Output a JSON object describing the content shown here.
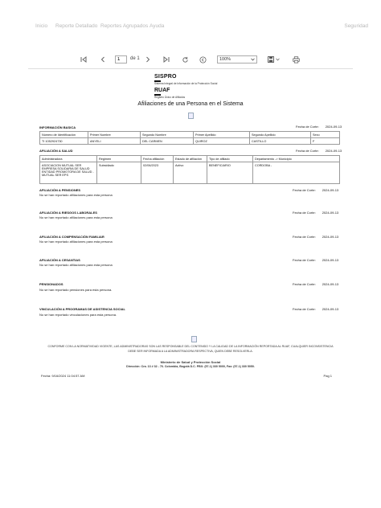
{
  "nav": {
    "items": [
      "Inicio",
      "Reporte Detallado",
      "Reportes Agrupados",
      "Ayuda"
    ],
    "security": "Seguridad"
  },
  "toolbar": {
    "page_value": "1",
    "of_label": "de 1",
    "zoom": "100%"
  },
  "logo": {
    "name1": "SISPRO",
    "sub1": "Sistema Integral de Información de la Protección Social",
    "name2": "RUAF",
    "sub2": "Registro Único de Afiliados"
  },
  "title": "Afiliaciones de una Persona en el Sistema",
  "cut_label": "Fecha de Corte:",
  "basic": {
    "title": "INFORMACIÓN BASICA",
    "date": "2024-09-13",
    "headers": [
      "Número de Identificación",
      "Primer Nombre",
      "Segundo Nombre",
      "Primer Apellido",
      "Segundo Apellido",
      "Sexo"
    ],
    "row": [
      "TI 1052924730",
      "ANYELI",
      "DEL CARMEN",
      "QUIROZ",
      "CASTILLO",
      "F"
    ]
  },
  "health": {
    "title": "AFILIACIÓN A SALUD",
    "date": "2024-09-13",
    "headers": [
      "Administradora",
      "Regimen",
      "Fecha afiliación",
      "Estado de afiliación",
      "Tipo de afiliado",
      "Departamento -> Municipio"
    ],
    "row": [
      "ASOCIACION MUTUAL SER EMPRESA SOLIDARIA DE SALUD ENTIDAD PROMOTORA DE SALUD - MUTUAL SER EPS",
      "Subsidiado",
      "02/06/2023",
      "Activo",
      "BENEFICIARIO",
      "CORDOBA -"
    ]
  },
  "sections": [
    {
      "title": "AFILIACIÓN A PENSIONES",
      "date": "2024-09-13",
      "empty": "No se han reportado afiliaciones para esta persona"
    },
    {
      "title": "AFILIACIÓN A RIESGOS LABORALES",
      "date": "2024-09-13",
      "empty": "No se han reportado afiliaciones para esta persona"
    },
    {
      "title": "AFILIACIÓN A COMPENSACIÓN FAMILIAR",
      "date": "2024-09-13",
      "empty": "No se han reportado afiliaciones para esta persona"
    },
    {
      "title": "AFILIACIÓN A CESANTIAS",
      "date": "2024-09-13",
      "empty": "No se han reportado afiliaciones para esta persona"
    },
    {
      "title": "PENSIONADOS",
      "date": "2024-09-13",
      "empty": "No se han reportado pensiones para esta persona."
    },
    {
      "title": "VINCULACIÓN A PROGRAMAS DE ASISTENCIA SOCIAL",
      "date": "2024-09-13",
      "empty": "No se han reportado vinculaciones para esta persona."
    }
  ],
  "footer": {
    "disclaimer1": "CONFORME CON LA NORMATIVIDAD VIGENTE, LAS ADMINISTRADORAS SON LAS RESPONSABLE DEL CONTENIDO Y LA CALIDAD DE LA INFORMACIÓN REPORTADA AL RUAF, CUALQUIER INCONSISTENCIA",
    "disclaimer2": "DEBE SER INFORMADA A LA ADMINISTRADORA RESPECTIVA, QUIEN DEBE RESOLVERLA.",
    "ministry": "Ministerio de Salud y Protección Social",
    "direction": "Dirección: Cra. 13 # 32 - 76. Colombia, Bogotá D.C. PBX: (57-1) 330 5000, Fax: (57-1) 330 5050.",
    "fecha": "Fecha: 9/16/2024 11:04:57 AM",
    "page": "Pag 1"
  }
}
